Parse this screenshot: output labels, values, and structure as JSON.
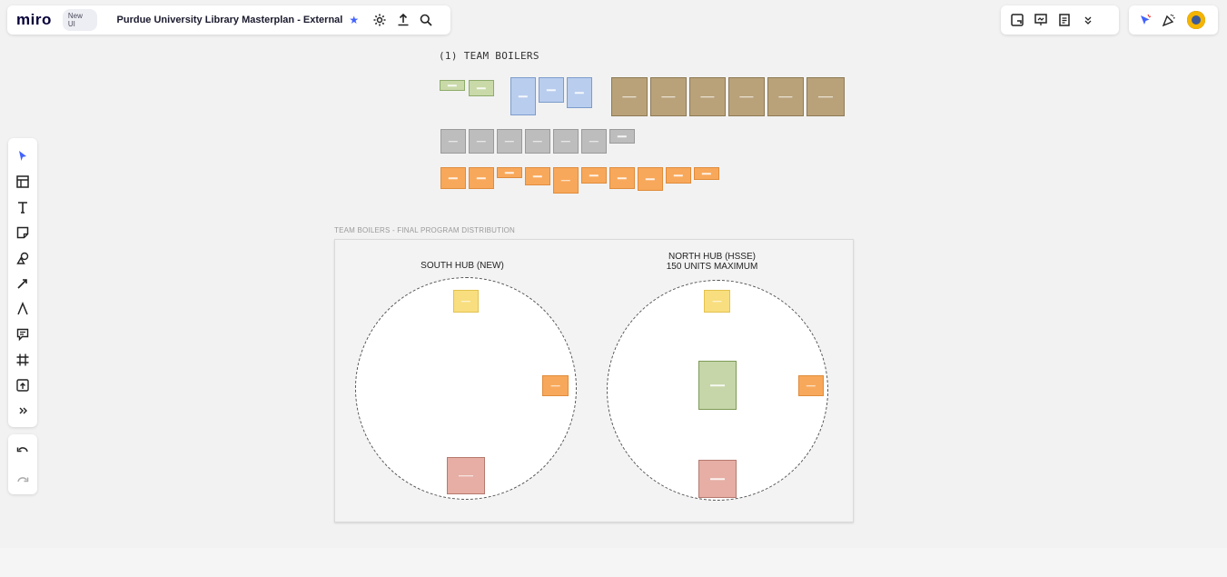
{
  "app": {
    "logo": "miro",
    "badge": "New UI",
    "board_title": "Purdue University Library Masterplan - External",
    "starred_icon": "star-icon"
  },
  "toolbar_top_left": [
    {
      "name": "settings-icon"
    },
    {
      "name": "share-upload-icon"
    },
    {
      "name": "search-icon"
    }
  ],
  "toolbar_top_right": [
    {
      "name": "sticky-add-icon"
    },
    {
      "name": "present-icon"
    },
    {
      "name": "notes-icon"
    },
    {
      "name": "more-chevron-icon"
    }
  ],
  "toolbar_collab": [
    {
      "name": "reactions-icon"
    },
    {
      "name": "celebrate-icon"
    },
    {
      "name": "user-avatar"
    }
  ],
  "left_tools": [
    "select-cursor-icon",
    "templates-icon",
    "text-icon",
    "sticky-note-icon",
    "shapes-icon",
    "connection-line-icon",
    "pen-icon",
    "comment-icon",
    "frame-icon",
    "upload-icon",
    "more-tools-icon"
  ],
  "undo_tools": [
    "undo-icon",
    "redo-icon"
  ],
  "canvas": {
    "section_title": "(1) TEAM BOILERS",
    "frame_label": "TEAM BOILERS - FINAL PROGRAM DISTRIBUTION",
    "south_hub": {
      "title": "SOUTH HUB (NEW)"
    },
    "north_hub": {
      "title_line1": "NORTH HUB (HSSE)",
      "title_line2": "150 UNITS MAXIMUM"
    }
  },
  "colors": {
    "accent": "#4262ff",
    "green_note": "#c9d9a8",
    "blue_note": "#b9cdee",
    "tan_note": "#b9a27a",
    "gray_note": "#bdbdbd",
    "orange_note": "#f8a85a",
    "yellow_note": "#f8de7e",
    "pink_note": "#e6aea4"
  }
}
